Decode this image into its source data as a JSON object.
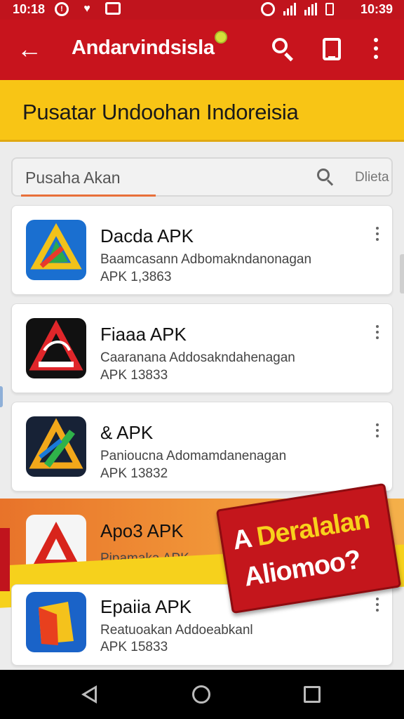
{
  "status_bar": {
    "time_left": "10:18",
    "time_right": "10:39",
    "icons": [
      "clock-icon",
      "wifi-signal-icon",
      "battery-icon"
    ]
  },
  "app_bar": {
    "title": "Andarvindsisla",
    "icons": [
      "back-arrow-icon",
      "search-icon",
      "bookmark-icon",
      "more-vert-icon"
    ]
  },
  "banner": {
    "text": "Pusatar Undoohan Indoreisia"
  },
  "search": {
    "placeholder": "Pusaha Akan",
    "action_label": "Dlieta"
  },
  "apps": [
    {
      "name": "Dacda APK",
      "description": "Baamcasann Adbomakndanonagan",
      "version": "APK 1,3863"
    },
    {
      "name": "Fiaaa APK",
      "description": "Caaranana Addosakndahenagan",
      "version": "APK 13833"
    },
    {
      "name": "& APK",
      "description": "Panioucna Adomamdanenagan",
      "version": "APK 13832"
    },
    {
      "name": "Apo3 APK",
      "description": "Pipamaka APK",
      "version": ""
    },
    {
      "name": "Epaiia APK",
      "description": "Reatuoakan Addoeabkanl",
      "version": "APK 15833"
    }
  ],
  "promo": {
    "line1_prefix": "A",
    "line1_highlight": "Deralalan",
    "line2": "Aliomoo?"
  },
  "colors": {
    "primary": "#c8141d",
    "banner": "#f8c515",
    "promo_orange": "#e8732a",
    "promo_yellow": "#f6d11c"
  },
  "nav_bar": {
    "icons": [
      "nav-back-icon",
      "nav-home-icon",
      "nav-recents-icon"
    ]
  }
}
